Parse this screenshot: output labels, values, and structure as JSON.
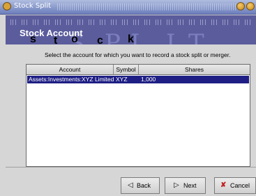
{
  "window": {
    "title": "Stock Split"
  },
  "banner": {
    "title": "Stock Account",
    "watermark_small": [
      "s",
      "t",
      "o",
      "c",
      "k"
    ],
    "watermark_large": [
      "S",
      "P",
      "L",
      "I",
      "T"
    ]
  },
  "instruction": "Select the account for which you want to record a stock split or merger.",
  "table": {
    "columns": [
      "Account",
      "Symbol",
      "Shares"
    ],
    "rows": [
      {
        "account": "Assets:Investments:XYZ Limited",
        "symbol": "XYZ",
        "shares": "1,000"
      }
    ]
  },
  "buttons": {
    "back": "Back",
    "next": "Next",
    "cancel": "Cancel"
  },
  "colors": {
    "banner_bg": "#5b5c9c",
    "selection": "#1e1e84",
    "cancel_icon": "#c02020"
  }
}
